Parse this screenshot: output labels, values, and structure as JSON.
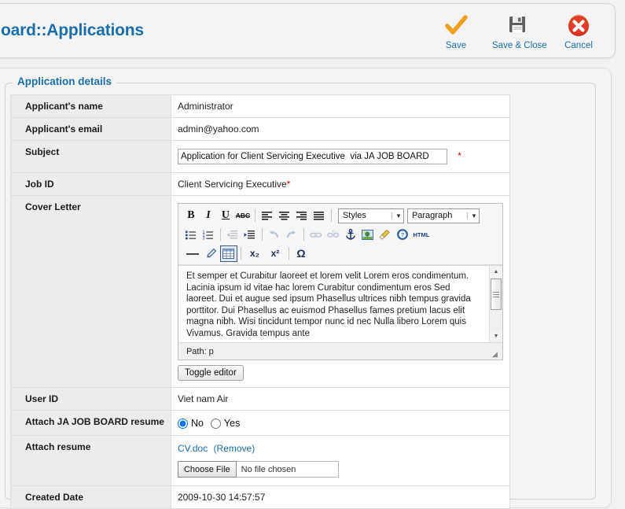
{
  "header": {
    "title": "oard::Applications",
    "toolbar": [
      {
        "label": "Save",
        "icon": "checkmark-icon"
      },
      {
        "label": "Save & Close",
        "icon": "floppy-disk-icon"
      },
      {
        "label": "Cancel",
        "icon": "cancel-circle-icon"
      }
    ]
  },
  "fieldset": {
    "legend": "Application details"
  },
  "form": {
    "applicant_name": {
      "label": "Applicant's name",
      "value": "Administrator"
    },
    "applicant_email": {
      "label": "Applicant's email",
      "value": "admin@yahoo.com"
    },
    "subject": {
      "label": "Subject",
      "value": "Application for Client Servicing Executive  via JA JOB BOARD",
      "required_marker": "*"
    },
    "job_id": {
      "label": "Job ID",
      "value": "Client Servicing Executive",
      "required_marker": "*"
    },
    "cover_letter": {
      "label": "Cover Letter",
      "body": "Et semper et Curabitur laoreet et lorem velit Lorem eros condimentum. Lacinia ipsum id vitae hac lorem Curabitur condimentum eros Sed laoreet. Dui et augue sed ipsum Phasellus ultrices nibh tempus gravida porttitor. Dui Phasellus ac euismod Phasellus fames pretium lacus elit magna nibh. Wisi tincidunt tempor nunc id nec Nulla libero Lorem quis Vivamus. Gravida tempus ante",
      "path_status": "Path: p",
      "toggle_button": "Toggle editor",
      "styles_select": "Styles",
      "paragraph_select": "Paragraph",
      "toolbar_icons": {
        "bold": "B",
        "italic": "I",
        "underline": "U",
        "strikethrough": "ABC",
        "align_left": "≡",
        "align_center": "≡",
        "align_right": "≡",
        "align_justify": "≡",
        "bullet_list": "☰",
        "numbered_list": "☰",
        "outdent": "⇤",
        "indent": "⇥",
        "undo": "↶",
        "redo": "↷",
        "link": "⛓",
        "unlink": "⛓",
        "anchor": "⚓",
        "image": "🌳",
        "cleanup": "🧹",
        "help": "?",
        "html": "HTML",
        "horizontal_rule": "—",
        "remove_format": "◢",
        "table": "▦",
        "subscript": "x₂",
        "superscript": "x²",
        "special_char": "Ω"
      }
    },
    "user_id": {
      "label": "User ID",
      "value": "Viet nam Air"
    },
    "attach_jobboard_resume": {
      "label": "Attach JA JOB BOARD resume",
      "options": [
        "No",
        "Yes"
      ],
      "selected": "No"
    },
    "attach_resume": {
      "label": "Attach resume",
      "file_link": "CV.doc",
      "remove_link": "(Remove)",
      "choose_button": "Choose File",
      "no_file_text": "No file chosen"
    },
    "created_date": {
      "label": "Created Date",
      "value": "2009-10-30 14:57:57"
    }
  },
  "colors": {
    "accent_blue": "#1b6eab",
    "required_red": "#cc0000",
    "save_orange": "#f0a01e",
    "cancel_red": "#d5331f"
  }
}
